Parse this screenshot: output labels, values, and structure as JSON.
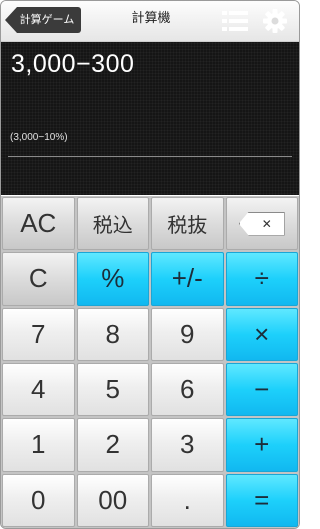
{
  "header": {
    "back_label": "計算ゲーム",
    "title": "計算機",
    "menu_icon": "menu-icon",
    "settings_icon": "gear-icon"
  },
  "display": {
    "expression": "3,000−300",
    "sub_expression": "(3,000−10%)"
  },
  "keypad": {
    "rows": [
      [
        "AC",
        "税込",
        "税抜",
        "⌫"
      ],
      [
        "C",
        "%",
        "+/-",
        "÷"
      ],
      [
        "7",
        "8",
        "9",
        "×"
      ],
      [
        "4",
        "5",
        "6",
        "−"
      ],
      [
        "1",
        "2",
        "3",
        "+"
      ],
      [
        "0",
        "00",
        ".",
        "="
      ]
    ]
  },
  "colors": {
    "accent_blue": "#1dd0fb",
    "display_bg": "#151515",
    "back_button": "#3b3b3b"
  }
}
